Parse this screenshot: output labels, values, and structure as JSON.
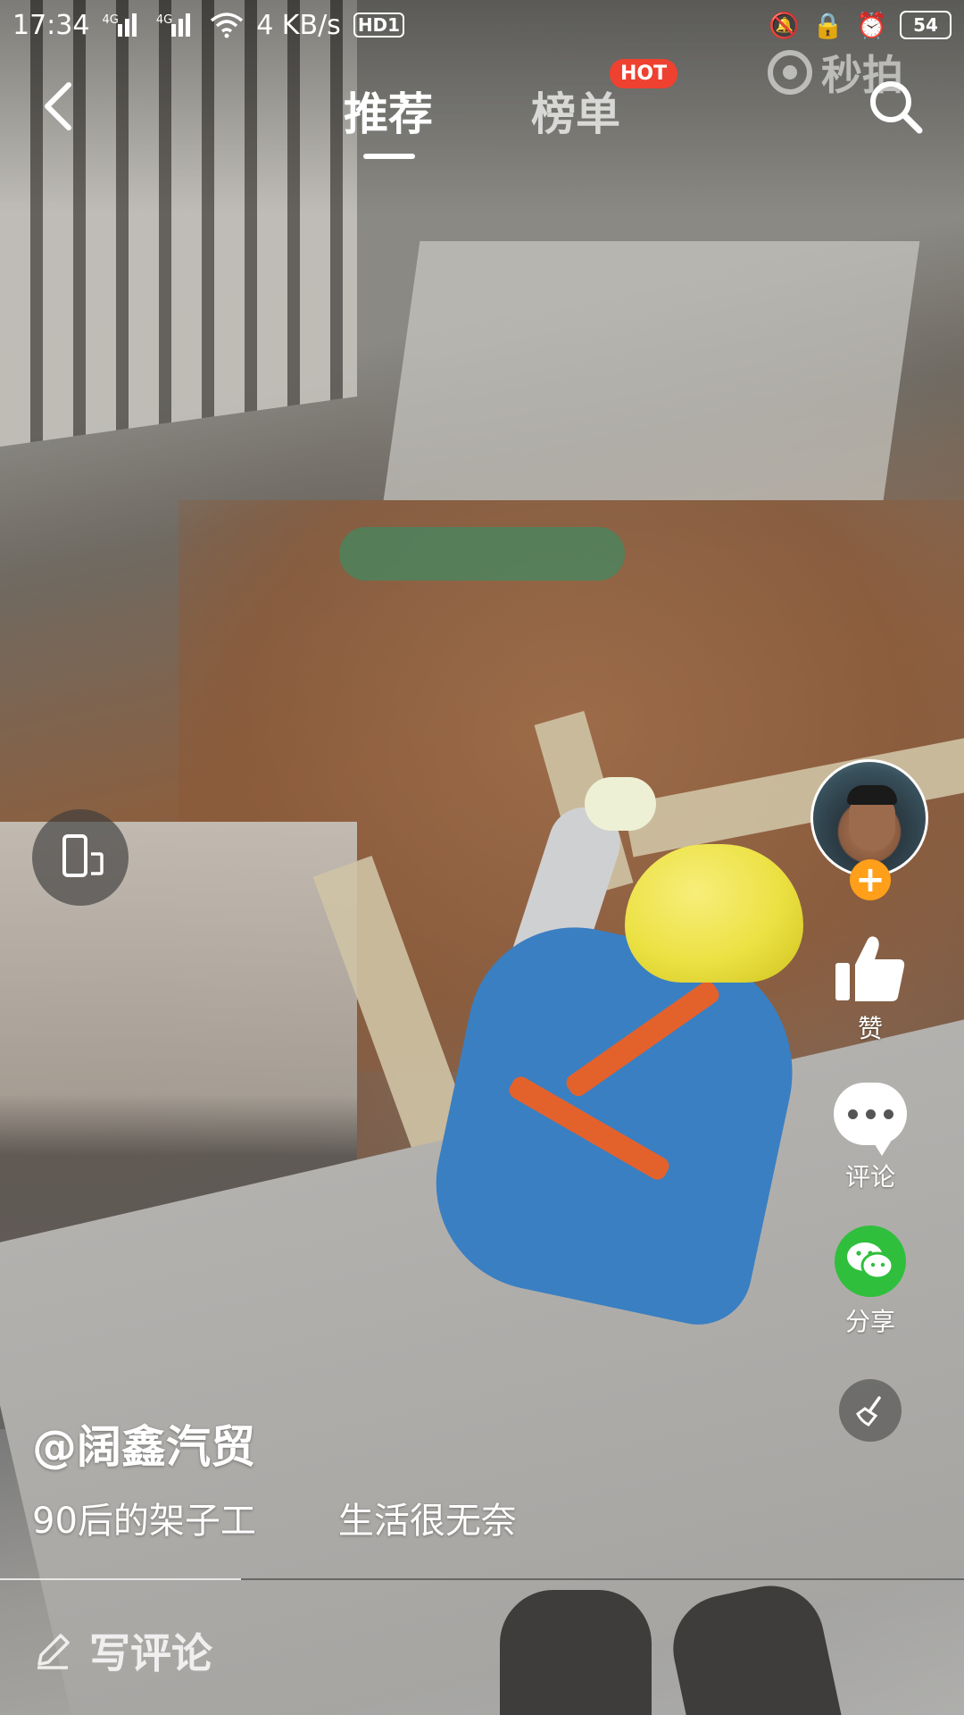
{
  "status_bar": {
    "time": "17:34",
    "sim1_tag": "4G",
    "sim2_tag": "4G",
    "net_speed": "4 KB/s",
    "hd_label": "HD1",
    "battery": "54",
    "icons": [
      "signal-icon",
      "wifi-icon",
      "vibrate-icon",
      "lock-rotation-icon",
      "alarm-icon",
      "battery-icon"
    ]
  },
  "watermark": {
    "text": "秒拍",
    "icon": "miaopai-logo-icon"
  },
  "nav": {
    "tabs": [
      {
        "label": "推荐",
        "active": true
      },
      {
        "label": "榜单",
        "active": false,
        "badge": "HOT"
      }
    ],
    "back_icon": "chevron-left-icon",
    "search_icon": "search-icon"
  },
  "actions": {
    "like_label": "赞",
    "comment_label": "评论",
    "share_label": "分享",
    "follow_symbol": "+"
  },
  "post": {
    "author": "@阔鑫汽贸",
    "caption_parts": [
      "90后的架子工",
      "生活很无奈"
    ]
  },
  "comment_box": {
    "placeholder": "写评论",
    "icon": "pencil-icon"
  },
  "colors": {
    "hot_badge": "#ef4130",
    "follow_plus": "#ff9f1a",
    "share_green": "#2fbf3c"
  }
}
